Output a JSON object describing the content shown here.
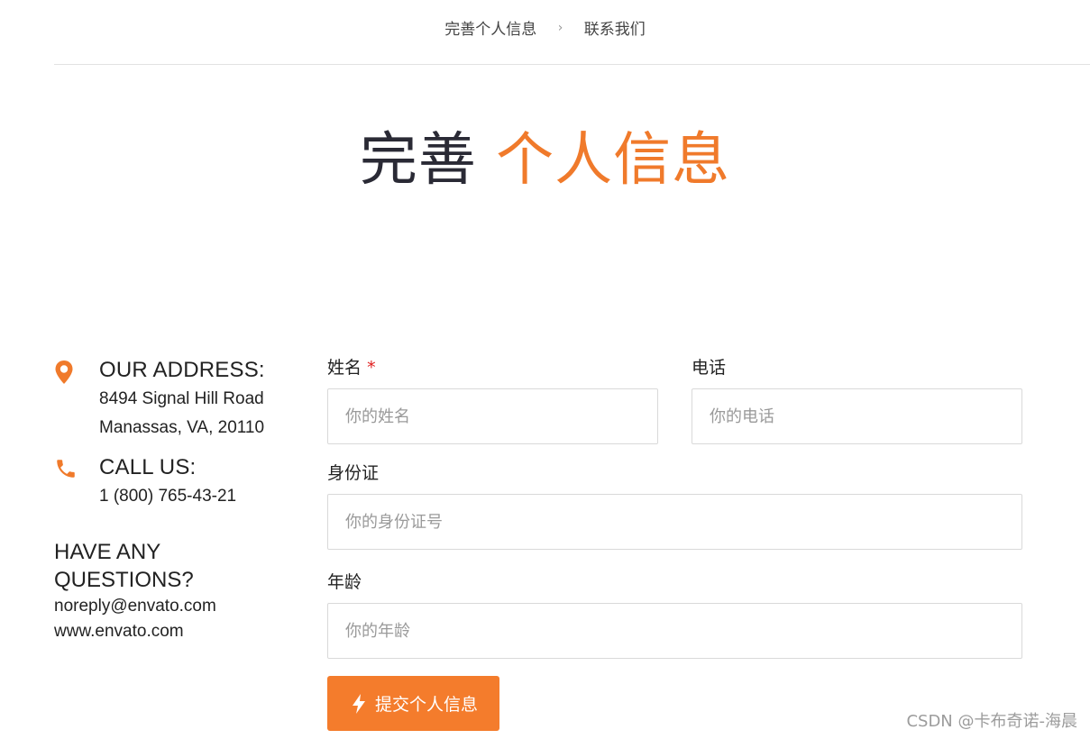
{
  "breadcrumb": {
    "items": [
      "完善个人信息",
      "联系我们"
    ],
    "separator": "›"
  },
  "title": {
    "part1": "完善",
    "part2": "个人信息"
  },
  "contact": {
    "address": {
      "icon": "location-pin-icon",
      "title": "OUR ADDRESS:",
      "line1": "8494 Signal Hill Road",
      "line2": "Manassas, VA, 20110"
    },
    "call": {
      "icon": "phone-icon",
      "title": "CALL US:",
      "line1": "1 (800) 765-43-21"
    },
    "questions": {
      "title": "HAVE ANY QUESTIONS?",
      "email": "noreply@envato.com",
      "website": "www.envato.com"
    }
  },
  "form": {
    "name": {
      "label": "姓名",
      "required_mark": "*",
      "placeholder": "你的姓名",
      "value": ""
    },
    "phone": {
      "label": "电话",
      "placeholder": "你的电话",
      "value": ""
    },
    "id_card": {
      "label": "身份证",
      "placeholder": "你的身份证号",
      "value": ""
    },
    "age": {
      "label": "年龄",
      "placeholder": "你的年龄",
      "value": ""
    },
    "submit": {
      "icon": "lightning-bolt-icon",
      "label": "提交个人信息"
    }
  },
  "watermark": "CSDN @卡布奇诺-海晨",
  "colors": {
    "accent": "#f07a2b",
    "button": "#f47c2c",
    "title_dark": "#2a2a35",
    "required": "#e02020"
  }
}
